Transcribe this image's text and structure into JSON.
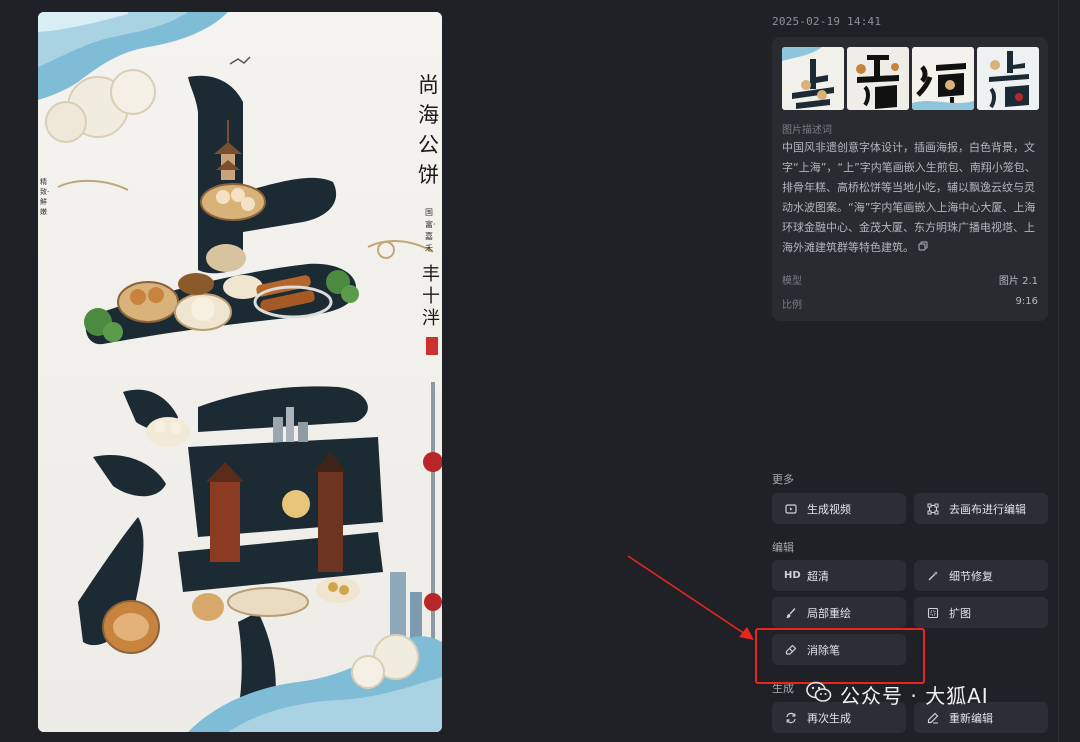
{
  "image": {
    "poster_title_chars": [
      "上",
      "海"
    ],
    "side_calligraphy": "尚海公饼",
    "side_small": "国富·嘉禾",
    "side_big": "丰十泮",
    "left_small": "精致·鮮嫩"
  },
  "panel": {
    "timestamp": "2025-02-19 14:41",
    "thumb_chars": [
      "上\n海",
      "上\n海",
      "海",
      "上\n海"
    ],
    "desc_label": "图片描述词",
    "description": "中国风非遗创意字体设计，插画海报，白色背景，文字“上海”，“上”字内笔画嵌入生煎包、南翔小笼包、排骨年糕、高桥松饼等当地小吃，辅以飘逸云纹与灵动水波图案。“海”字内笔画嵌入上海中心大厦、上海环球金融中心、金茂大厦、东方明珠广播电视塔、上海外滩建筑群等特色建筑。",
    "meta": [
      {
        "key": "模型",
        "value": "图片 2.1"
      },
      {
        "key": "比例",
        "value": "9:16"
      }
    ]
  },
  "sections": {
    "more": "更多",
    "edit": "编辑",
    "generate": "生成"
  },
  "buttons": {
    "generate_video": "生成视频",
    "canvas_edit": "去画布进行编辑",
    "hd": "超清",
    "hd_prefix": "HD",
    "detail_fix": "细节修复",
    "inpaint": "局部重绘",
    "expand": "扩图",
    "eraser": "消除笔",
    "regenerate": "再次生成",
    "reedit": "重新编辑"
  },
  "watermark": {
    "text": "公众号 · 大狐AI"
  },
  "colors": {
    "background": "#202126",
    "card": "#2a2b31",
    "button": "#2d2e35",
    "highlight": "#e8251f",
    "ink": "#1c2a33",
    "wave": "#6fb3cf"
  }
}
